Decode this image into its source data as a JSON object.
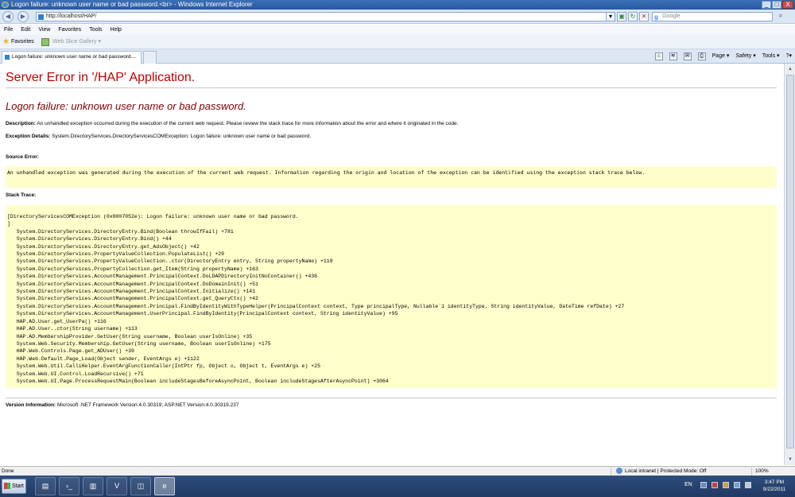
{
  "window": {
    "title": "Logon failure: unknown user name or bad password.<br> - Windows Internet Explorer",
    "buttons": [
      "_",
      "□",
      "X"
    ]
  },
  "address_bar": {
    "url": "http://localhost/HAP/",
    "search_placeholder": "Google",
    "back_icon": "back-arrow-icon",
    "forward_icon": "forward-arrow-icon"
  },
  "menu": [
    "File",
    "Edit",
    "View",
    "Favorites",
    "Tools",
    "Help"
  ],
  "favorites_bar": {
    "label": "Favorites",
    "web_slice": "Web Slice Gallery ▾"
  },
  "tabs": [
    {
      "label": "Logon failure: unknown user name or bad password...."
    }
  ],
  "command_bar": {
    "page": "Page ▾",
    "safety": "Safety ▾",
    "tools": "Tools ▾",
    "help": "?▾"
  },
  "page": {
    "heading": "Server Error in '/HAP' Application.",
    "error_title": "Logon failure: unknown user name or bad password.",
    "description_label": "Description:",
    "description": "An unhandled exception occurred during the execution of the current web request. Please review the stack trace for more information about the error and where it originated in the code.",
    "exception_label": "Exception Details:",
    "exception": "System.DirectoryServices.DirectoryServicesCOMException: Logon failure: unknown user name or bad password.",
    "source_label": "Source Error:",
    "source_text": "An unhandled exception was generated during the execution of the current web request. Information regarding the origin and location of the exception can be identified using the exception stack trace below.",
    "stack_label": "Stack Trace:",
    "stack_lines": [
      "[DirectoryServicesCOMException (0x8007052e): Logon failure: unknown user name or bad password.",
      "]",
      "   System.DirectoryServices.DirectoryEntry.Bind(Boolean throwIfFail) +781",
      "   System.DirectoryServices.DirectoryEntry.Bind() +44",
      "   System.DirectoryServices.DirectoryEntry.get_AdsObject() +42",
      "   System.DirectoryServices.PropertyValueCollection.PopulateList() +29",
      "   System.DirectoryServices.PropertyValueCollection..ctor(DirectoryEntry entry, String propertyName) +119",
      "   System.DirectoryServices.PropertyCollection.get_Item(String propertyName) +163",
      "   System.DirectoryServices.AccountManagement.PrincipalContext.DoLDAPDirectoryInitNoContainer() +436",
      "   System.DirectoryServices.AccountManagement.PrincipalContext.DoDomainInit() +51",
      "   System.DirectoryServices.AccountManagement.PrincipalContext.Initialize() +141",
      "   System.DirectoryServices.AccountManagement.PrincipalContext.get_QueryCtx() +42",
      "   System.DirectoryServices.AccountManagement.Principal.FindByIdentityWithTypeHelper(PrincipalContext context, Type principalType, Nullable`1 identityType, String identityValue, DateTime refDate) +27",
      "   System.DirectoryServices.AccountManagement.UserPrincipal.FindByIdentity(PrincipalContext context, String identityValue) +95",
      "   HAP.AD.User.get_UserPa() +116",
      "   HAP.AD.User..ctor(String username) +113",
      "   HAP.AD.MembershipProvider.GetUser(String username, Boolean userIsOnline) +35",
      "   System.Web.Security.Membership.GetUser(String username, Boolean userIsOnline) +175",
      "   HAP.Web.Controls.Page.get_ADUser() +39",
      "   HAP.Web.Default.Page_Load(Object sender, EventArgs e) +1122",
      "   System.Web.Util.CalliHelper.EventArgFunctionCaller(IntPtr fp, Object o, Object t, EventArgs e) +25",
      "   System.Web.UI.Control.LoadRecursive() +71",
      "   System.Web.UI.Page.ProcessRequestMain(Boolean includeStagesBeforeAsyncPoint, Boolean includeStagesAfterAsyncPoint) +3064"
    ],
    "version_label": "Version Information:",
    "version": "Microsoft .NET Framework Version:4.0.30319; ASP.NET Version:4.0.30319.237"
  },
  "status_bar": {
    "status": "Done",
    "zone": "Local intranet | Protected Mode: Off",
    "zoom": "100%"
  },
  "taskbar": {
    "start": "Start",
    "lang": "EN",
    "time": "3:47 PM",
    "date": "9/22/2011"
  }
}
